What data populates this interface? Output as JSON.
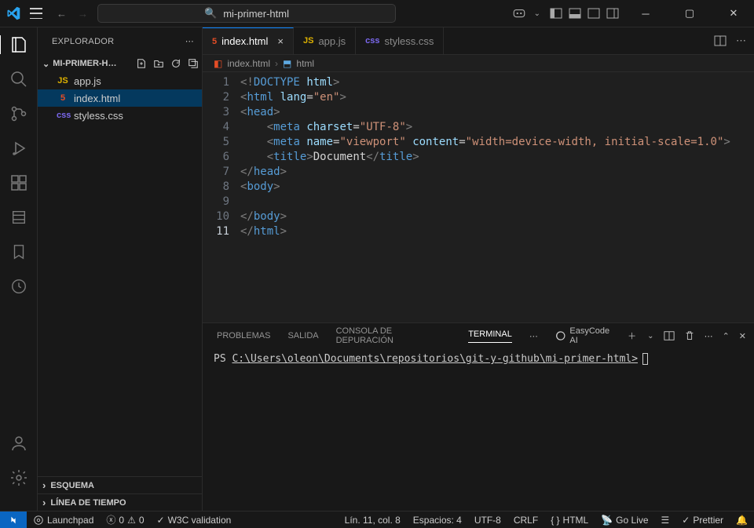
{
  "titlebar": {
    "search_label": "mi-primer-html"
  },
  "sidebar": {
    "title": "EXPLORADOR",
    "folder": "MI-PRIMER-H…",
    "files": [
      {
        "icon": "JS",
        "name": "app.js",
        "cls": "ic-js"
      },
      {
        "icon": "5",
        "name": "index.html",
        "cls": "ic-html",
        "selected": true
      },
      {
        "icon": "css",
        "name": "styless.css",
        "cls": "ic-css"
      }
    ],
    "sections": [
      "ESQUEMA",
      "LÍNEA DE TIEMPO"
    ]
  },
  "tabs": [
    {
      "icon": "5",
      "cls": "ic-html",
      "label": "index.html",
      "active": true,
      "close": "×"
    },
    {
      "icon": "JS",
      "cls": "ic-js",
      "label": "app.js"
    },
    {
      "icon": "css",
      "cls": "ic-css",
      "label": "styless.css"
    }
  ],
  "breadcrumbs": {
    "file": "index.html",
    "symbol": "html"
  },
  "code_html": "<span class='t-gray'>&lt;!</span><span class='t-blue'>DOCTYPE</span> <span class='t-attr'>html</span><span class='t-gray'>&gt;</span>\n<span class='t-gray'>&lt;</span><span class='t-blue'>html</span> <span class='t-attr'>lang</span>=<span class='t-str'>\"en\"</span><span class='t-gray'>&gt;</span>\n<span class='t-gray'>&lt;</span><span class='t-blue'>head</span><span class='t-gray'>&gt;</span>\n    <span class='t-gray'>&lt;</span><span class='t-blue'>meta</span> <span class='t-attr'>charset</span>=<span class='t-str'>\"UTF-8\"</span><span class='t-gray'>&gt;</span>\n    <span class='t-gray'>&lt;</span><span class='t-blue'>meta</span> <span class='t-attr'>name</span>=<span class='t-str'>\"viewport\"</span> <span class='t-attr'>content</span>=<span class='t-str'>\"width=device-width, initial-scale=1.0\"</span><span class='t-gray'>&gt;</span>\n    <span class='t-gray'>&lt;</span><span class='t-blue'>title</span><span class='t-gray'>&gt;</span><span class='t-white'>Document</span><span class='t-gray'>&lt;/</span><span class='t-blue'>title</span><span class='t-gray'>&gt;</span>\n<span class='t-gray'>&lt;/</span><span class='t-blue'>head</span><span class='t-gray'>&gt;</span>\n<span class='t-gray'>&lt;</span><span class='t-blue'>body</span><span class='t-gray'>&gt;</span>\n    \n<span class='t-gray'>&lt;/</span><span class='t-blue'>body</span><span class='t-gray'>&gt;</span>\n<span class='t-gray'>&lt;/</span><span class='t-blue'>html</span><span class='t-gray'>&gt;</span>",
  "lines": 11,
  "current_line": 11,
  "panel": {
    "tabs": [
      "PROBLEMAS",
      "SALIDA",
      "CONSOLA DE DEPURACIÓN",
      "TERMINAL"
    ],
    "active_tab": 3,
    "easycode": "EasyCode AI",
    "term_prefix": "PS ",
    "term_path": "C:\\Users\\oleon\\Documents\\repositorios\\git-y-github\\mi-primer-html>"
  },
  "status": {
    "launchpad": "Launchpad",
    "errors": "0",
    "warnings": "0",
    "w3c": "W3C validation",
    "cursor": "Lín. 11, col. 8",
    "spaces": "Espacios: 4",
    "encoding": "UTF-8",
    "eol": "CRLF",
    "lang": "HTML",
    "golive": "Go Live",
    "prettier": "Prettier"
  }
}
